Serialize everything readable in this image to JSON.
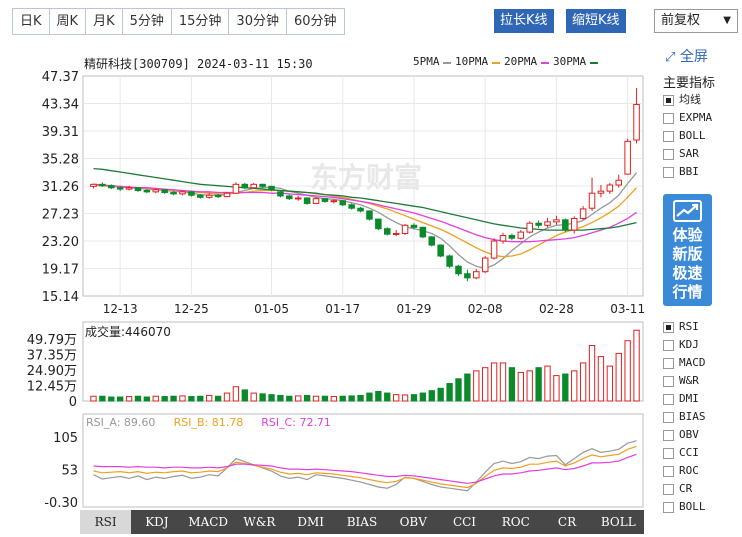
{
  "tabs": [
    {
      "label": "日K",
      "active": true
    },
    {
      "label": "周K",
      "active": false
    },
    {
      "label": "月K",
      "active": false
    },
    {
      "label": "5分钟",
      "active": false
    },
    {
      "label": "15分钟",
      "active": false
    },
    {
      "label": "30分钟",
      "active": false
    },
    {
      "label": "60分钟",
      "active": false
    }
  ],
  "toolbar": {
    "widen_label": "拉长K线",
    "shorten_label": "缩短K线",
    "adjust_label": "前复权"
  },
  "header": {
    "stock": "精研科技[300709] 2024-03-11 15:30"
  },
  "watermark": "东方财富",
  "ma_legend": [
    {
      "label": "5PMA",
      "color": "#999999"
    },
    {
      "label": "10PMA",
      "color": "#f0a020"
    },
    {
      "label": "20PMA",
      "color": "#e040e0"
    },
    {
      "label": "30PMA",
      "color": "#1e7a3c"
    }
  ],
  "sidebar": {
    "fullscreen_label": "全屏",
    "indicators_title": "主要指标",
    "main_indicators": [
      {
        "label": "均线",
        "checked": true
      },
      {
        "label": "EXPMA",
        "checked": false
      },
      {
        "label": "BOLL",
        "checked": false
      },
      {
        "label": "SAR",
        "checked": false
      },
      {
        "label": "BBI",
        "checked": false
      }
    ],
    "promo_text": [
      "体验",
      "新版",
      "极速",
      "行情"
    ],
    "sub_indicators": [
      {
        "label": "RSI",
        "checked": true
      },
      {
        "label": "KDJ",
        "checked": false
      },
      {
        "label": "MACD",
        "checked": false
      },
      {
        "label": "W&R",
        "checked": false
      },
      {
        "label": "DMI",
        "checked": false
      },
      {
        "label": "BIAS",
        "checked": false
      },
      {
        "label": "OBV",
        "checked": false
      },
      {
        "label": "CCI",
        "checked": false
      },
      {
        "label": "ROC",
        "checked": false
      },
      {
        "label": "CR",
        "checked": false
      },
      {
        "label": "BOLL",
        "checked": false
      }
    ]
  },
  "bottom_tabs": [
    {
      "label": "RSI",
      "active": true
    },
    {
      "label": "KDJ",
      "active": false
    },
    {
      "label": "MACD",
      "active": false
    },
    {
      "label": "W&R",
      "active": false
    },
    {
      "label": "DMI",
      "active": false
    },
    {
      "label": "BIAS",
      "active": false
    },
    {
      "label": "OBV",
      "active": false
    },
    {
      "label": "CCI",
      "active": false
    },
    {
      "label": "ROC",
      "active": false
    },
    {
      "label": "CR",
      "active": false
    },
    {
      "label": "BOLL",
      "active": false
    }
  ],
  "colors": {
    "up": "#e02020",
    "down": "#0a8a2a",
    "grid": "#e8e8e8"
  },
  "chart_data": [
    {
      "type": "candlestick",
      "ylim": [
        15.14,
        47.37
      ],
      "y_ticks": [
        "47.37",
        "43.34",
        "39.31",
        "35.28",
        "31.26",
        "27.23",
        "23.20",
        "19.17",
        "15.14"
      ],
      "x_ticks": [
        {
          "label": "12-13",
          "index": 3
        },
        {
          "label": "12-25",
          "index": 11
        },
        {
          "label": "01-05",
          "index": 20
        },
        {
          "label": "01-17",
          "index": 28
        },
        {
          "label": "01-29",
          "index": 36
        },
        {
          "label": "02-08",
          "index": 44
        },
        {
          "label": "02-28",
          "index": 52
        },
        {
          "label": "03-11",
          "index": 60
        }
      ],
      "candles": [
        [
          31.2,
          31.5,
          30.9,
          31.6
        ],
        [
          31.5,
          31.3,
          31.1,
          31.8
        ],
        [
          31.3,
          31.0,
          30.8,
          31.5
        ],
        [
          31.0,
          30.8,
          30.5,
          31.2
        ],
        [
          30.8,
          31.0,
          30.6,
          31.3
        ],
        [
          31.0,
          30.6,
          30.4,
          31.1
        ],
        [
          30.6,
          30.4,
          30.2,
          30.8
        ],
        [
          30.4,
          30.7,
          30.2,
          30.9
        ],
        [
          30.7,
          30.3,
          30.1,
          30.8
        ],
        [
          30.3,
          30.1,
          29.9,
          30.5
        ],
        [
          30.1,
          30.4,
          29.9,
          30.6
        ],
        [
          30.4,
          29.9,
          29.7,
          30.5
        ],
        [
          29.9,
          29.6,
          29.4,
          30.1
        ],
        [
          29.6,
          29.9,
          29.4,
          30.2
        ],
        [
          29.9,
          29.7,
          29.5,
          30.1
        ],
        [
          29.7,
          30.2,
          29.6,
          30.4
        ],
        [
          30.2,
          31.5,
          30.1,
          31.8
        ],
        [
          31.5,
          31.0,
          30.8,
          31.7
        ],
        [
          31.0,
          31.5,
          30.9,
          31.7
        ],
        [
          31.5,
          31.2,
          31.0,
          31.6
        ],
        [
          31.2,
          30.8,
          30.5,
          31.3
        ],
        [
          30.4,
          29.8,
          29.6,
          30.5
        ],
        [
          29.8,
          29.4,
          29.2,
          30.0
        ],
        [
          29.4,
          29.5,
          29.1,
          29.8
        ],
        [
          29.5,
          28.7,
          28.5,
          29.6
        ],
        [
          28.7,
          29.4,
          28.6,
          29.6
        ],
        [
          29.4,
          29.0,
          28.8,
          29.5
        ],
        [
          29.0,
          29.1,
          28.7,
          29.3
        ],
        [
          29.1,
          28.5,
          28.3,
          29.2
        ],
        [
          28.5,
          28.0,
          27.8,
          28.7
        ],
        [
          28.0,
          27.6,
          27.4,
          28.2
        ],
        [
          27.6,
          26.4,
          26.2,
          27.7
        ],
        [
          26.4,
          25.0,
          24.8,
          26.5
        ],
        [
          25.0,
          24.2,
          24.0,
          25.2
        ],
        [
          24.2,
          24.3,
          23.9,
          24.8
        ],
        [
          24.3,
          25.5,
          24.1,
          25.7
        ],
        [
          25.5,
          25.2,
          24.9,
          25.8
        ],
        [
          25.2,
          23.8,
          23.6,
          25.3
        ],
        [
          23.8,
          22.6,
          22.4,
          23.9
        ],
        [
          22.6,
          21.0,
          20.8,
          22.7
        ],
        [
          21.0,
          19.5,
          19.2,
          21.2
        ],
        [
          19.5,
          18.4,
          18.1,
          19.7
        ],
        [
          18.4,
          17.8,
          17.3,
          19.0
        ],
        [
          17.8,
          18.7,
          17.6,
          19.1
        ],
        [
          18.7,
          20.7,
          18.5,
          21.0
        ],
        [
          20.7,
          23.2,
          20.5,
          23.6
        ],
        [
          23.2,
          24.0,
          22.8,
          24.4
        ],
        [
          24.0,
          23.6,
          23.3,
          24.3
        ],
        [
          23.6,
          24.5,
          23.4,
          24.8
        ],
        [
          24.5,
          25.8,
          24.3,
          26.1
        ],
        [
          25.8,
          25.5,
          25.1,
          26.2
        ],
        [
          25.5,
          26.0,
          25.2,
          26.6
        ],
        [
          26.0,
          26.3,
          25.6,
          26.9
        ],
        [
          26.3,
          24.8,
          24.5,
          26.5
        ],
        [
          24.8,
          26.5,
          24.3,
          26.8
        ],
        [
          26.5,
          27.9,
          26.3,
          28.3
        ],
        [
          28.0,
          30.2,
          27.6,
          32.5
        ],
        [
          30.2,
          30.5,
          29.6,
          31.4
        ],
        [
          30.5,
          31.4,
          30.1,
          31.7
        ],
        [
          31.4,
          32.1,
          31.0,
          32.9
        ],
        [
          33.0,
          37.8,
          32.9,
          38.2
        ],
        [
          38.0,
          43.2,
          37.5,
          45.6
        ]
      ],
      "ma5": [
        31.4,
        31.3,
        31.2,
        31.1,
        31.0,
        30.9,
        30.8,
        30.7,
        30.6,
        30.5,
        30.4,
        30.2,
        30.0,
        29.9,
        29.9,
        30.0,
        30.3,
        30.6,
        30.9,
        31.0,
        31.1,
        30.9,
        30.5,
        30.2,
        29.9,
        29.6,
        29.4,
        29.3,
        29.1,
        28.8,
        28.5,
        28.0,
        27.4,
        26.6,
        25.9,
        25.3,
        25.0,
        24.7,
        24.3,
        23.6,
        22.5,
        21.2,
        20.1,
        19.5,
        19.2,
        19.7,
        20.6,
        21.8,
        22.8,
        23.8,
        24.5,
        25.1,
        25.5,
        25.6,
        25.8,
        26.2,
        27.1,
        28.0,
        28.8,
        29.9,
        31.6,
        33.2
      ],
      "ma10": [
        31.3,
        31.3,
        31.2,
        31.2,
        31.1,
        31.0,
        30.9,
        30.8,
        30.7,
        30.6,
        30.5,
        30.4,
        30.3,
        30.2,
        30.1,
        30.1,
        30.2,
        30.3,
        30.5,
        30.6,
        30.6,
        30.6,
        30.5,
        30.4,
        30.3,
        30.1,
        30.0,
        29.8,
        29.6,
        29.3,
        29.0,
        28.7,
        28.3,
        27.9,
        27.4,
        26.9,
        26.4,
        25.9,
        25.4,
        24.9,
        24.3,
        23.6,
        22.9,
        22.2,
        21.6,
        21.1,
        20.9,
        21.0,
        21.3,
        21.9,
        22.6,
        23.3,
        24.0,
        24.5,
        24.9,
        25.3,
        25.9,
        26.6,
        27.4,
        28.3,
        29.6,
        31.0
      ],
      "ma20": [
        31.5,
        31.4,
        31.3,
        31.2,
        31.1,
        31.0,
        31.0,
        30.9,
        30.8,
        30.7,
        30.6,
        30.5,
        30.4,
        30.4,
        30.3,
        30.3,
        30.3,
        30.3,
        30.3,
        30.3,
        30.2,
        30.2,
        30.1,
        30.0,
        29.9,
        29.8,
        29.7,
        29.6,
        29.4,
        29.2,
        29.0,
        28.8,
        28.5,
        28.2,
        27.9,
        27.6,
        27.3,
        26.9,
        26.5,
        26.1,
        25.6,
        25.1,
        24.6,
        24.1,
        23.7,
        23.4,
        23.2,
        23.1,
        23.1,
        23.1,
        23.2,
        23.3,
        23.4,
        23.5,
        23.7,
        24.0,
        24.4,
        24.8,
        25.2,
        25.8,
        26.5,
        27.4
      ],
      "ma30": [
        33.8,
        33.7,
        33.5,
        33.3,
        33.1,
        32.9,
        32.7,
        32.5,
        32.3,
        32.1,
        31.9,
        31.7,
        31.5,
        31.4,
        31.3,
        31.2,
        31.1,
        31.0,
        30.9,
        30.8,
        30.7,
        30.6,
        30.5,
        30.4,
        30.3,
        30.2,
        30.0,
        29.9,
        29.8,
        29.6,
        29.5,
        29.3,
        29.1,
        28.9,
        28.7,
        28.5,
        28.3,
        28.1,
        27.8,
        27.5,
        27.2,
        26.9,
        26.6,
        26.3,
        26.0,
        25.7,
        25.5,
        25.3,
        25.1,
        25.0,
        24.9,
        24.8,
        24.8,
        24.8,
        24.8,
        24.8,
        24.9,
        25.0,
        25.1,
        25.3,
        25.6,
        25.9
      ]
    },
    {
      "type": "bar",
      "title": "成交量:446070",
      "y_ticks": [
        "49.79万",
        "37.35万",
        "24.90万",
        "12.45万",
        "0"
      ],
      "ylim": [
        0,
        49.79
      ],
      "unit": "万",
      "values": [
        3,
        3,
        2.5,
        2.5,
        2.8,
        3,
        2.5,
        3,
        2.8,
        3,
        3.2,
        2.8,
        3,
        3.5,
        3,
        5,
        9,
        7,
        5,
        4.5,
        4,
        3.5,
        3,
        3.2,
        3.5,
        3,
        3,
        2.8,
        3,
        3.2,
        3.5,
        5,
        6,
        5,
        4,
        3.8,
        4,
        5,
        6.5,
        8,
        11,
        14,
        17,
        19,
        21,
        24,
        24,
        21,
        18,
        19,
        21,
        22,
        16,
        17,
        19,
        24,
        35,
        28,
        22,
        30,
        38,
        44.6
      ]
    },
    {
      "type": "line",
      "ylim": [
        -0.3,
        105
      ],
      "y_ticks": [
        "105",
        "53",
        "-0.30"
      ],
      "series": [
        {
          "name": "RSI_A: 89.60",
          "color": "#999999",
          "values": [
            44,
            37,
            39,
            41,
            38,
            42,
            36,
            40,
            38,
            41,
            43,
            38,
            40,
            44,
            42,
            55,
            70,
            65,
            60,
            55,
            50,
            42,
            38,
            40,
            36,
            44,
            42,
            40,
            38,
            35,
            32,
            28,
            24,
            22,
            28,
            40,
            38,
            33,
            28,
            24,
            22,
            20,
            18,
            32,
            48,
            62,
            66,
            62,
            65,
            72,
            70,
            74,
            75,
            60,
            70,
            80,
            86,
            80,
            82,
            85,
            95,
            99
          ]
        },
        {
          "name": "RSI_B: 81.78",
          "color": "#f0a020",
          "values": [
            50,
            47,
            48,
            49,
            47,
            49,
            46,
            48,
            47,
            49,
            50,
            47,
            48,
            50,
            49,
            55,
            64,
            62,
            59,
            56,
            53,
            48,
            45,
            46,
            44,
            47,
            46,
            45,
            43,
            41,
            39,
            36,
            33,
            31,
            33,
            39,
            38,
            35,
            32,
            29,
            27,
            25,
            23,
            30,
            41,
            51,
            55,
            54,
            56,
            61,
            61,
            64,
            66,
            58,
            63,
            70,
            76,
            73,
            75,
            77,
            85,
            90
          ]
        },
        {
          "name": "RSI_C: 72.71",
          "color": "#e040e0",
          "values": [
            58,
            57,
            57,
            57,
            56,
            57,
            56,
            56,
            55,
            56,
            56,
            55,
            55,
            56,
            55,
            57,
            61,
            61,
            60,
            59,
            58,
            55,
            53,
            53,
            52,
            53,
            52,
            51,
            50,
            49,
            47,
            45,
            43,
            41,
            41,
            43,
            42,
            40,
            38,
            36,
            34,
            32,
            30,
            32,
            37,
            42,
            45,
            45,
            47,
            50,
            51,
            53,
            55,
            52,
            54,
            58,
            63,
            63,
            64,
            66,
            72,
            77
          ]
        }
      ]
    }
  ]
}
